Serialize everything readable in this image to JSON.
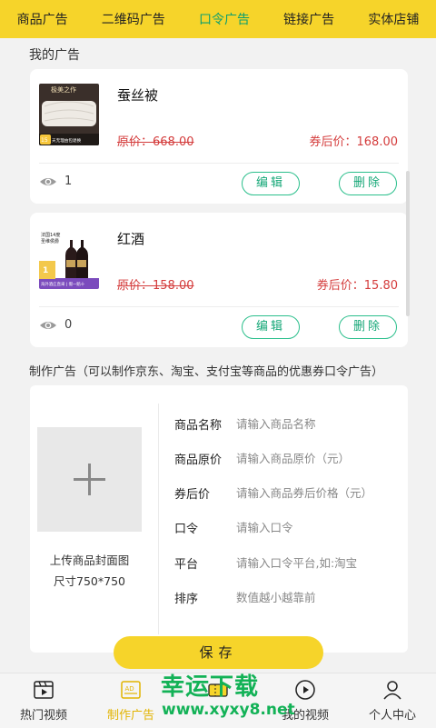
{
  "top_tabs": [
    "商品广告",
    "二维码广告",
    "口令广告",
    "链接广告",
    "实体店铺"
  ],
  "active_tab": "口令广告",
  "my_ads_title": "我的广告",
  "ads": [
    {
      "name": "蚕丝被",
      "original_price": "原价：668.00",
      "after_coupon_price": "券后价：168.00",
      "views": "1",
      "edit_label": "编辑",
      "delete_label": "删除",
      "image": {
        "headline": "极美之作",
        "badge_num": "15",
        "badge_text": "天无理由包退换"
      }
    },
    {
      "name": "红酒",
      "original_price": "原价：158.00",
      "after_coupon_price": "券后价：15.80",
      "views": "0",
      "edit_label": "编辑",
      "delete_label": "删除",
      "image": {
        "top_text": "法国14度",
        "top_text2": "圣维侯爵",
        "bottom_text": "海外酒庄直采 | 假一赔十",
        "num": "1"
      }
    }
  ],
  "create_section_title": "制作广告（可以制作京东、淘宝、支付宝等商品的优惠券口令广告）",
  "upload": {
    "label_line1": "上传商品封面图",
    "label_line2": "尺寸750*750"
  },
  "form_fields": [
    {
      "label": "商品名称",
      "placeholder": "请输入商品名称"
    },
    {
      "label": "商品原价",
      "placeholder": "请输入商品原价（元）"
    },
    {
      "label": "券后价",
      "placeholder": "请输入商品券后价格（元）"
    },
    {
      "label": "口令",
      "placeholder": "请输入口令"
    },
    {
      "label": "平台",
      "placeholder": "请输入口令平台,如:淘宝"
    },
    {
      "label": "排序",
      "placeholder": "数值越小越靠前"
    }
  ],
  "save_label": "保存",
  "bottom_tabs": [
    {
      "label": "热门视频",
      "icon": "film-icon"
    },
    {
      "label": "制作广告",
      "icon": "ad-icon"
    },
    {
      "label": "",
      "icon": "ticket-icon"
    },
    {
      "label": "我的视频",
      "icon": "play-circle-icon"
    },
    {
      "label": "个人中心",
      "icon": "person-icon"
    }
  ],
  "active_bottom_tab": 1,
  "watermark": {
    "title": "幸运下载",
    "url": "www.xyxy8.net"
  },
  "colors": {
    "brand_yellow": "#f6d42a",
    "active_green": "#0e9f6e",
    "price_red": "#d43c3c",
    "button_green": "#2bbf8c"
  }
}
